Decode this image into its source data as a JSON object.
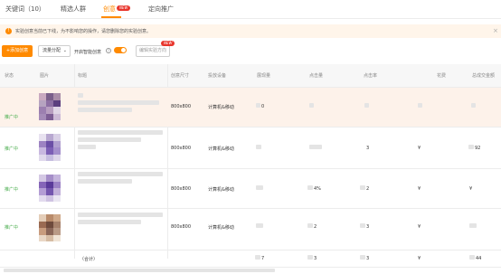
{
  "tabs": [
    {
      "label": "关键词（10）",
      "active": false
    },
    {
      "label": "精选人群",
      "active": false
    },
    {
      "label": "创意",
      "active": true,
      "badge": "NEW"
    },
    {
      "label": "定向推广",
      "active": false
    }
  ],
  "notice": {
    "text": "实验创意当前已下线，为不影响您的操作，请您删除您的实验创意。",
    "icon": "warning-icon"
  },
  "toolbar": {
    "add_label": "+添加创意",
    "group_label": "流量分配",
    "smart_label": "开启智能创意",
    "smart_on": true,
    "exp_label": "编辑实验方向",
    "exp_badge": "NEW"
  },
  "columns": [
    "状态",
    "图片",
    "标题",
    "创意尺寸",
    "投放设备",
    "展现量",
    "点击量",
    "点击率",
    "花费",
    "总成交金额"
  ],
  "rows": [
    {
      "status": "推广中",
      "size": "800x800",
      "device": "计算机&移动",
      "impressions": "0",
      "clicks": "",
      "ctr": "",
      "cost": "",
      "gmv": "",
      "highlight": true,
      "thumb": [
        "#c9a9c0",
        "#7a5f8a",
        "#a98da8",
        "#b6a3c0",
        "#8d6fa3",
        "#5c3f7f",
        "#9c7fb0",
        "#b89ec0",
        "#e0d5e6",
        "#a58bb8",
        "#7d5d94",
        "#cdbad6"
      ]
    },
    {
      "status": "推广中",
      "size": "800x800",
      "device": "计算机&移动",
      "impressions": "",
      "clicks": "",
      "ctr": "3",
      "cost": "¥",
      "gmv": "92",
      "highlight": false,
      "thumb": [
        "#e8e2f0",
        "#b8a8d0",
        "#d9d0e6",
        "#9d83c2",
        "#6b4fa6",
        "#b1a0d0",
        "#c8b8e0",
        "#7c5fb5",
        "#a48fcc",
        "#e0d9ec",
        "#c6bde0",
        "#ded7ea"
      ]
    },
    {
      "status": "推广中",
      "size": "800x800",
      "device": "计算机&移动",
      "impressions": "",
      "clicks": "4%",
      "ctr": "2",
      "cost": "¥",
      "gmv": "¥",
      "highlight": false,
      "thumb": [
        "#d4c8e4",
        "#a58ec8",
        "#c4b4dc",
        "#8565b8",
        "#5a3a9a",
        "#9c82c6",
        "#b39dd4",
        "#7456ae",
        "#c2b0da",
        "#e2dbee",
        "#cfc3e2",
        "#eae6f2"
      ]
    },
    {
      "status": "推广中",
      "size": "800x800",
      "device": "计算机&移动",
      "impressions": "",
      "clicks": "2",
      "ctr": "3",
      "cost": "¥",
      "gmv": "",
      "highlight": false,
      "thumb": [
        "#e4cdb8",
        "#b88a6a",
        "#cfa98a",
        "#9a6a52",
        "#6e4a3c",
        "#a7826c",
        "#c89c7e",
        "#8a6658",
        "#b99a86",
        "#e9d7c6",
        "#d6bca4",
        "#f0e4d6"
      ]
    }
  ],
  "total": {
    "label": "（合计）",
    "impressions": "7",
    "clicks": "3",
    "ctr": "3",
    "cost": "¥",
    "gmv": "44"
  }
}
